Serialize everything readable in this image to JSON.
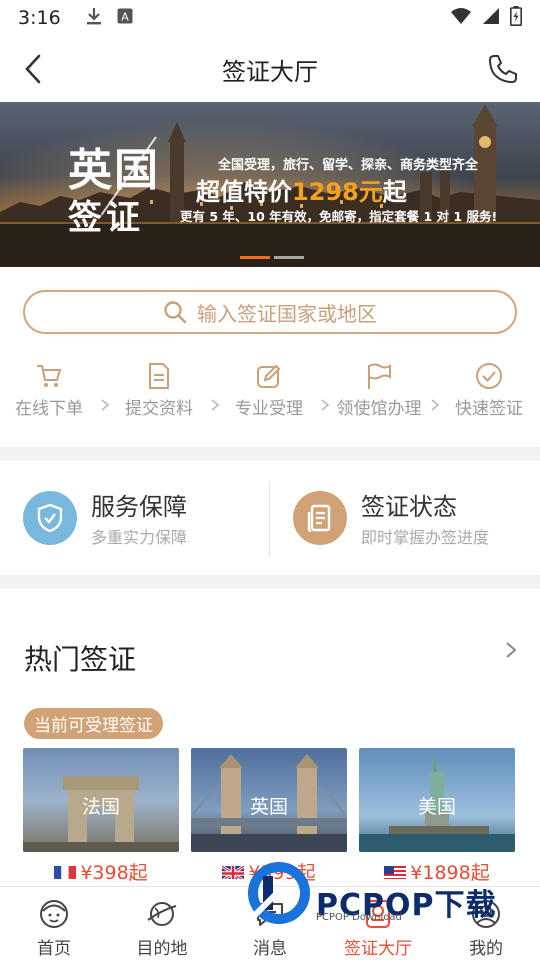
{
  "status_bar": {
    "time": "3:16"
  },
  "nav": {
    "title": "签证大厅"
  },
  "banner": {
    "big_line1": "英国",
    "big_line2": "签证",
    "line1": "全国受理，旅行、留学、探亲、商务类型齐全",
    "line2_pre": "超值特价",
    "line2_price": "1298元",
    "line2_post": "起",
    "line3": "更有 5 年、10 年有效，免邮寄，指定套餐 1 对 1 服务!",
    "active_slide": 1,
    "slide_count": 2
  },
  "search": {
    "placeholder": "输入签证国家或地区"
  },
  "steps": [
    {
      "label": "在线下单",
      "icon": "cart-icon"
    },
    {
      "label": "提交资料",
      "icon": "document-icon"
    },
    {
      "label": "专业受理",
      "icon": "edit-icon"
    },
    {
      "label": "领使馆办理",
      "icon": "flag-icon"
    },
    {
      "label": "快速签证",
      "icon": "check-circle-icon"
    }
  ],
  "services": [
    {
      "title": "服务保障",
      "subtitle": "多重实力保障",
      "icon": "shield-icon",
      "color": "#7ab7dc"
    },
    {
      "title": "签证状态",
      "subtitle": "即时掌握办签进度",
      "icon": "clipboard-icon",
      "color": "#d2a277"
    }
  ],
  "hot": {
    "title": "热门签证",
    "badge": "当前可受理签证",
    "cards": [
      {
        "name": "法国",
        "price": "¥398起",
        "flag": "france-flag"
      },
      {
        "name": "英国",
        "price": "¥399起",
        "flag": "uk-flag"
      },
      {
        "name": "美国",
        "price": "¥1898起",
        "flag": "us-flag"
      }
    ]
  },
  "tabs": [
    {
      "label": "首页",
      "icon": "home-face-icon",
      "active": false
    },
    {
      "label": "目的地",
      "icon": "planet-icon",
      "active": false
    },
    {
      "label": "消息",
      "icon": "message-icon",
      "active": false
    },
    {
      "label": "签证大厅",
      "icon": "visa-hall-icon",
      "active": true
    },
    {
      "label": "我的",
      "icon": "profile-icon",
      "active": false
    }
  ],
  "watermark": {
    "text": "PCPOP下载",
    "sub": "PCPOP Download"
  },
  "colors": {
    "accent": "#e94c35",
    "gold": "#d2a277",
    "blue": "#7ab7dc",
    "orange": "#f26b1d"
  }
}
